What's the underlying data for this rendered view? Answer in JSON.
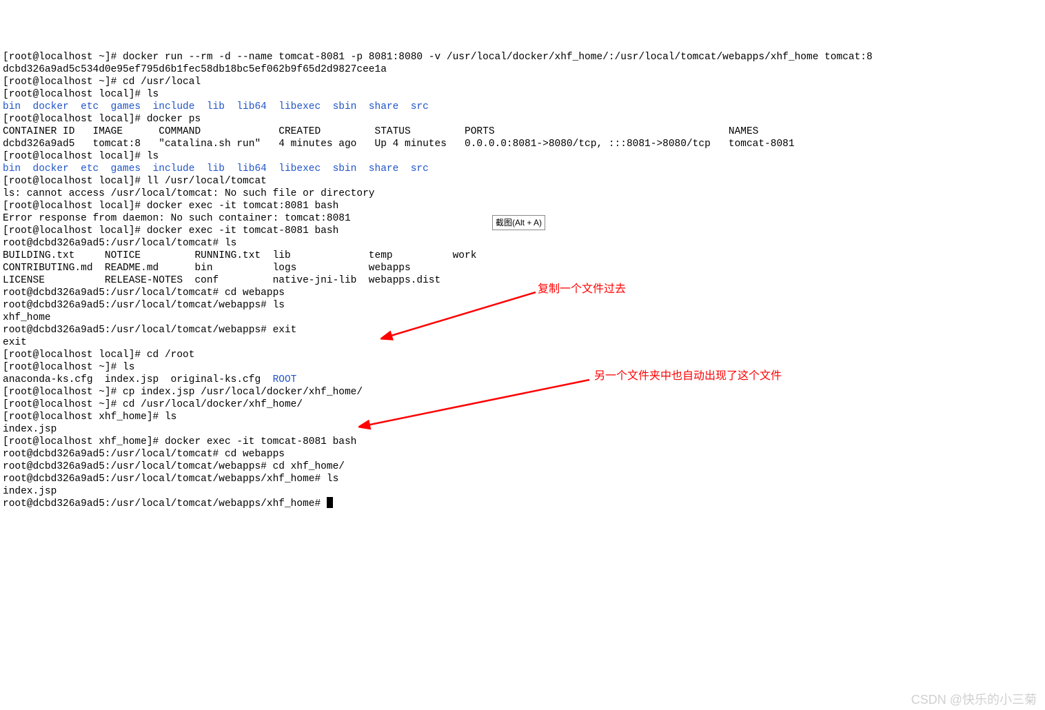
{
  "lines": {
    "l01a": "[root@localhost ~]# docker run --rm -d --name tomcat-8081 -p 8081:8080 -v /usr/local/docker/xhf_home/:/usr/local/tomcat/webapps/xhf_home tomcat:8",
    "l01b": "dcbd326a9ad5c534d0e95ef795d6b1fec58db18bc5ef062b9f65d2d9827cee1a",
    "l02": "[root@localhost ~]# cd /usr/local",
    "l03": "[root@localhost local]# ls",
    "l04_dirs": "bin  docker  etc  games  include  lib  lib64  libexec  sbin  share  src",
    "l05": "[root@localhost local]# docker ps",
    "l06": "CONTAINER ID   IMAGE      COMMAND             CREATED         STATUS         PORTS                                       NAMES",
    "l07": "dcbd326a9ad5   tomcat:8   \"catalina.sh run\"   4 minutes ago   Up 4 minutes   0.0.0.0:8081->8080/tcp, :::8081->8080/tcp   tomcat-8081",
    "l08": "[root@localhost local]# ls",
    "l09_dirs": "bin  docker  etc  games  include  lib  lib64  libexec  sbin  share  src",
    "l10": "[root@localhost local]# ll /usr/local/tomcat",
    "l11": "ls: cannot access /usr/local/tomcat: No such file or directory",
    "l12": "[root@localhost local]# docker exec -it tomcat:8081 bash",
    "l13": "Error response from daemon: No such container: tomcat:8081",
    "l14": "[root@localhost local]# docker exec -it tomcat-8081 bash",
    "l15": "root@dcbd326a9ad5:/usr/local/tomcat# ls",
    "l16": "BUILDING.txt     NOTICE         RUNNING.txt  lib             temp          work",
    "l17": "CONTRIBUTING.md  README.md      bin          logs            webapps",
    "l18": "LICENSE          RELEASE-NOTES  conf         native-jni-lib  webapps.dist",
    "l19": "root@dcbd326a9ad5:/usr/local/tomcat# cd webapps",
    "l20": "root@dcbd326a9ad5:/usr/local/tomcat/webapps# ls",
    "l21": "xhf_home",
    "l22": "root@dcbd326a9ad5:/usr/local/tomcat/webapps# exit",
    "l23": "exit",
    "l24": "[root@localhost local]# cd /root",
    "l25": "[root@localhost ~]# ls",
    "l26a": "anaconda-ks.cfg  index.jsp  original-ks.cfg  ",
    "l26b": "ROOT",
    "l27": "[root@localhost ~]# cp index.jsp /usr/local/docker/xhf_home/",
    "l28": "[root@localhost ~]# cd /usr/local/docker/xhf_home/",
    "l29": "[root@localhost xhf_home]# ls",
    "l30": "index.jsp",
    "l31": "[root@localhost xhf_home]# docker exec -it tomcat-8081 bash",
    "l32": "root@dcbd326a9ad5:/usr/local/tomcat# cd webapps",
    "l33": "root@dcbd326a9ad5:/usr/local/tomcat/webapps# cd xhf_home/",
    "l34": "root@dcbd326a9ad5:/usr/local/tomcat/webapps/xhf_home# ls",
    "l35": "index.jsp",
    "l36": "root@dcbd326a9ad5:/usr/local/tomcat/webapps/xhf_home# "
  },
  "tooltip": "截图(Alt + A)",
  "annotations": {
    "a1": "复制一个文件过去",
    "a2": "另一个文件夹中也自动出现了这个文件"
  },
  "watermark": "CSDN @快乐的小三菊"
}
